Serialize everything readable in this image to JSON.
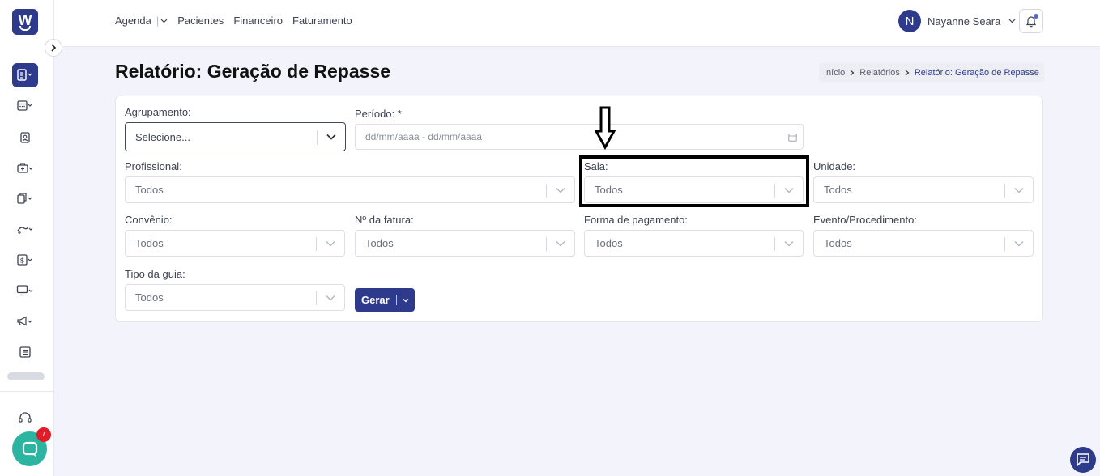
{
  "app": {
    "logo_letter": "W"
  },
  "topnav": {
    "agenda": "Agenda",
    "separator": "|",
    "pacientes": "Pacientes",
    "financeiro": "Financeiro",
    "faturamento": "Faturamento"
  },
  "user": {
    "initial": "N",
    "name": "Nayanne Seara"
  },
  "page": {
    "title": "Relatório: Geração de Repasse"
  },
  "breadcrumb": {
    "home": "Início",
    "reports": "Relatórios",
    "current": "Relatório: Geração de Repasse"
  },
  "form": {
    "agrupamento": {
      "label": "Agrupamento:",
      "value": "Selecione..."
    },
    "periodo": {
      "label": "Período: *",
      "placeholder": "dd/mm/aaaa - dd/mm/aaaa"
    },
    "profissional": {
      "label": "Profissional:",
      "value": "Todos"
    },
    "sala": {
      "label": "Sala:",
      "value": "Todos"
    },
    "unidade": {
      "label": "Unidade:",
      "value": "Todos"
    },
    "convenio": {
      "label": "Convênio:",
      "value": "Todos"
    },
    "fatura": {
      "label": "Nº da fatura:",
      "value": "Todos"
    },
    "pagamento": {
      "label": "Forma de pagamento:",
      "value": "Todos"
    },
    "evento": {
      "label": "Evento/Procedimento:",
      "value": "Todos"
    },
    "guia": {
      "label": "Tipo da guia:",
      "value": "Todos"
    },
    "submit_label": "Gerar"
  },
  "chat": {
    "badge_count": "7"
  },
  "colors": {
    "primary": "#2e3a8c",
    "chat": "#2bb5a1",
    "badge": "#e11d2a",
    "highlight": "#000000"
  }
}
